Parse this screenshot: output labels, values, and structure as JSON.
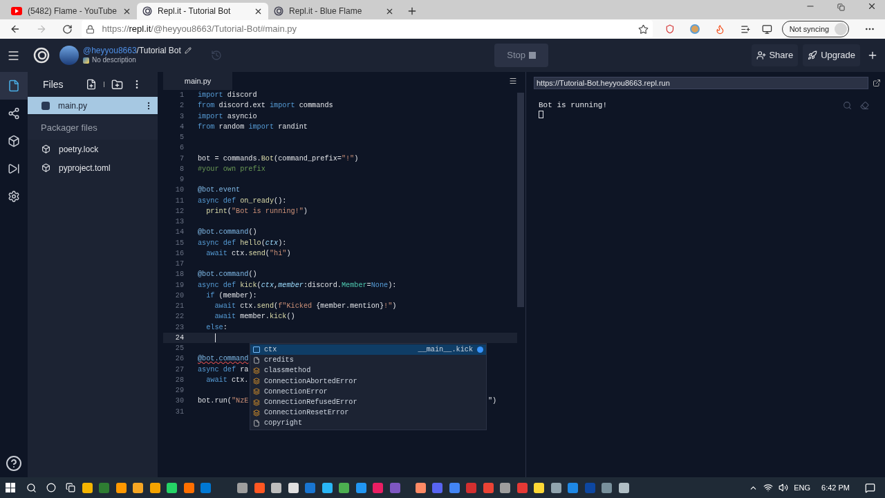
{
  "browser": {
    "tabs": [
      {
        "title": "(5482) Flame - YouTube",
        "kind": "youtube",
        "selected": false
      },
      {
        "title": "Repl.it - Tutorial Bot",
        "kind": "repl",
        "selected": true
      },
      {
        "title": "Repl.it - Blue Flame",
        "kind": "repl",
        "selected": false
      }
    ],
    "url": {
      "host": "repl.it",
      "path": "/@heyyou8663/Tutorial-Bot#main.py",
      "scheme": "https://"
    },
    "sync": "Not syncing"
  },
  "header": {
    "owner": "@heyyou8663",
    "repl": "/Tutorial Bot",
    "description": "No description",
    "run_button": "Stop",
    "share": "Share",
    "upgrade": "Upgrade"
  },
  "rail": [
    {
      "kind": "files",
      "selected": true
    },
    {
      "kind": "share",
      "selected": false
    },
    {
      "kind": "packages",
      "selected": false
    },
    {
      "kind": "debug",
      "selected": false
    },
    {
      "kind": "settings",
      "selected": false
    }
  ],
  "files": {
    "title": "Files",
    "items": [
      {
        "name": "main.py",
        "selected": true
      }
    ],
    "section": "Packager files",
    "packages": [
      {
        "name": "poetry.lock"
      },
      {
        "name": "pyproject.toml"
      }
    ]
  },
  "editor": {
    "tab": "main.py",
    "lines": [
      {
        "no": "1",
        "current": false,
        "tokens": [
          {
            "t": "import",
            "kind": "kw"
          },
          {
            "t": " discord",
            "kind": "pl"
          }
        ]
      },
      {
        "no": "2",
        "current": false,
        "tokens": [
          {
            "t": "from",
            "kind": "kw"
          },
          {
            "t": " discord.ext ",
            "kind": "pl"
          },
          {
            "t": "import",
            "kind": "kw"
          },
          {
            "t": " commands",
            "kind": "pl"
          }
        ]
      },
      {
        "no": "3",
        "current": false,
        "tokens": [
          {
            "t": "import",
            "kind": "kw"
          },
          {
            "t": " asyncio",
            "kind": "pl"
          }
        ]
      },
      {
        "no": "4",
        "current": false,
        "tokens": [
          {
            "t": "from",
            "kind": "kw"
          },
          {
            "t": " random ",
            "kind": "pl"
          },
          {
            "t": "import",
            "kind": "kw"
          },
          {
            "t": " randint",
            "kind": "pl"
          }
        ]
      },
      {
        "no": "5",
        "current": false
      },
      {
        "no": "6",
        "current": false
      },
      {
        "no": "7",
        "current": false,
        "tokens": [
          {
            "t": "bot = commands.",
            "kind": "pl"
          },
          {
            "t": "Bot",
            "kind": "fn"
          },
          {
            "t": "(command_prefix=",
            "kind": "pl"
          },
          {
            "t": "\"!\"",
            "kind": "str"
          },
          {
            "t": ")",
            "kind": "pl"
          }
        ]
      },
      {
        "no": "8",
        "current": false,
        "tokens": [
          {
            "t": "#your own prefix",
            "kind": "cm"
          }
        ]
      },
      {
        "no": "9",
        "current": false
      },
      {
        "no": "10",
        "current": false,
        "tokens": [
          {
            "t": "@bot.event",
            "kind": "dec"
          }
        ]
      },
      {
        "no": "11",
        "current": false,
        "tokens": [
          {
            "t": "async def ",
            "kind": "kw"
          },
          {
            "t": "on_ready",
            "kind": "fn"
          },
          {
            "t": "():",
            "kind": "pl"
          }
        ]
      },
      {
        "no": "12",
        "current": false,
        "tokens": [
          {
            "t": "  print",
            "kind": "fn"
          },
          {
            "t": "(",
            "kind": "pl"
          },
          {
            "t": "\"Bot is running!\"",
            "kind": "str"
          },
          {
            "t": ")",
            "kind": "pl"
          }
        ]
      },
      {
        "no": "13",
        "current": false
      },
      {
        "no": "14",
        "current": false,
        "tokens": [
          {
            "t": "@bot.command",
            "kind": "dec"
          },
          {
            "t": "()",
            "kind": "pl"
          }
        ]
      },
      {
        "no": "15",
        "current": false,
        "tokens": [
          {
            "t": "async def ",
            "kind": "kw"
          },
          {
            "t": "hello",
            "kind": "fn"
          },
          {
            "t": "(",
            "kind": "pl"
          },
          {
            "t": "ctx",
            "kind": "prm"
          },
          {
            "t": "):",
            "kind": "pl"
          }
        ]
      },
      {
        "no": "16",
        "current": false,
        "tokens": [
          {
            "t": "  await",
            "kind": "kw"
          },
          {
            "t": " ctx.",
            "kind": "pl"
          },
          {
            "t": "send",
            "kind": "fn"
          },
          {
            "t": "(",
            "kind": "pl"
          },
          {
            "t": "\"hi\"",
            "kind": "str"
          },
          {
            "t": ")",
            "kind": "pl"
          }
        ]
      },
      {
        "no": "17",
        "current": false
      },
      {
        "no": "18",
        "current": false,
        "tokens": [
          {
            "t": "@bot.command",
            "kind": "dec"
          },
          {
            "t": "()",
            "kind": "pl"
          }
        ]
      },
      {
        "no": "19",
        "current": false,
        "tokens": [
          {
            "t": "async def ",
            "kind": "kw"
          },
          {
            "t": "kick",
            "kind": "fn"
          },
          {
            "t": "(",
            "kind": "pl"
          },
          {
            "t": "ctx",
            "kind": "prm"
          },
          {
            "t": ",",
            "kind": "pl"
          },
          {
            "t": "member",
            "kind": "prm"
          },
          {
            "t": ":discord.",
            "kind": "pl"
          },
          {
            "t": "Member",
            "kind": "ty"
          },
          {
            "t": "=",
            "kind": "pl"
          },
          {
            "t": "None",
            "kind": "kw"
          },
          {
            "t": "):",
            "kind": "pl"
          }
        ]
      },
      {
        "no": "20",
        "current": false,
        "tokens": [
          {
            "t": "  if",
            "kind": "kw"
          },
          {
            "t": " (member):",
            "kind": "pl"
          }
        ]
      },
      {
        "no": "21",
        "current": false,
        "tokens": [
          {
            "t": "    await",
            "kind": "kw"
          },
          {
            "t": " ctx.",
            "kind": "pl"
          },
          {
            "t": "send",
            "kind": "fn"
          },
          {
            "t": "(",
            "kind": "pl"
          },
          {
            "t": "f\"Kicked ",
            "kind": "str"
          },
          {
            "t": "{member.mention}",
            "kind": "pl"
          },
          {
            "t": "!\"",
            "kind": "str"
          },
          {
            "t": ")",
            "kind": "pl"
          }
        ]
      },
      {
        "no": "22",
        "current": false,
        "tokens": [
          {
            "t": "    await",
            "kind": "kw"
          },
          {
            "t": " member.",
            "kind": "pl"
          },
          {
            "t": "kick",
            "kind": "fn"
          },
          {
            "t": "()",
            "kind": "pl"
          }
        ]
      },
      {
        "no": "23",
        "current": false,
        "tokens": [
          {
            "t": "  else",
            "kind": "kw"
          },
          {
            "t": ":",
            "kind": "pl"
          }
        ]
      },
      {
        "no": "24",
        "current": true
      },
      {
        "no": "25",
        "current": false
      },
      {
        "no": "26",
        "current": false,
        "tokens": [
          {
            "t": "@bot.command",
            "kind": "err"
          }
        ]
      },
      {
        "no": "27",
        "current": false,
        "tokens": [
          {
            "t": "async def ",
            "kind": "kw"
          },
          {
            "t": "ra",
            "kind": "pl"
          }
        ]
      },
      {
        "no": "28",
        "current": false,
        "tokens": [
          {
            "t": "  await",
            "kind": "kw"
          },
          {
            "t": " ctx.",
            "kind": "pl"
          }
        ]
      },
      {
        "no": "29",
        "current": false
      },
      {
        "no": "30",
        "current": false,
        "tokens": [
          {
            "t": "bot.run(",
            "kind": "pl"
          },
          {
            "t": "\"NzE",
            "kind": "str"
          }
        ],
        "tail": "\")"
      },
      {
        "no": "31",
        "current": false
      }
    ],
    "suggestions": [
      {
        "label": "ctx",
        "kind": "variable",
        "selected": true,
        "detail": "__main__.kick"
      },
      {
        "label": "credits",
        "kind": "text",
        "selected": false
      },
      {
        "label": "classmethod",
        "kind": "class",
        "selected": false
      },
      {
        "label": "ConnectionAbortedError",
        "kind": "class",
        "selected": false
      },
      {
        "label": "ConnectionError",
        "kind": "class",
        "selected": false
      },
      {
        "label": "ConnectionRefusedError",
        "kind": "class",
        "selected": false
      },
      {
        "label": "ConnectionResetError",
        "kind": "class",
        "selected": false
      },
      {
        "label": "copyright",
        "kind": "text",
        "selected": false
      }
    ]
  },
  "console": {
    "url": "https://Tutorial-Bot.heyyou8663.repl.run",
    "output": "Bot is running!"
  },
  "taskbar": {
    "language": "ENG",
    "time": "6:42 PM"
  }
}
